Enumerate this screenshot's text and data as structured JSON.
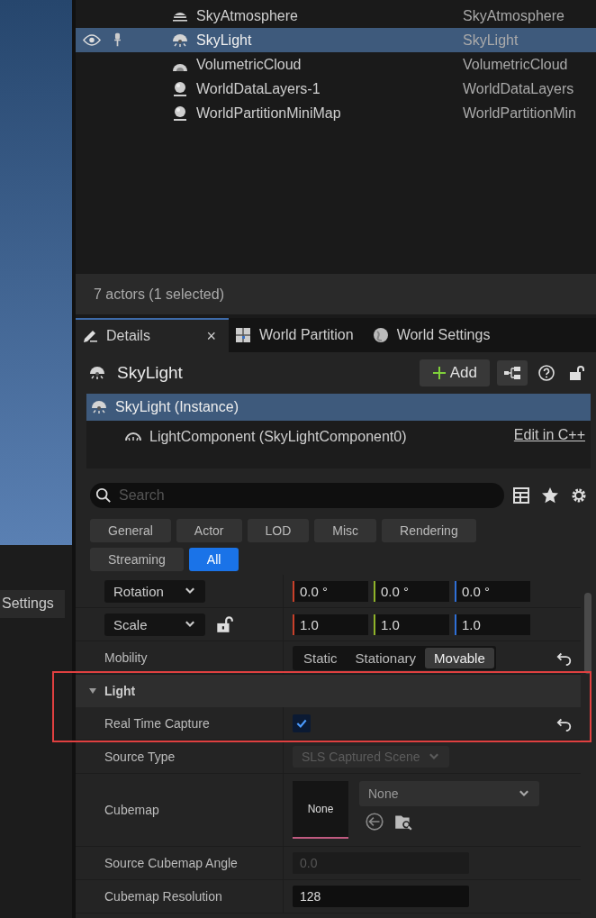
{
  "outliner": {
    "rows": [
      {
        "label": "SkyAtmosphere",
        "type": "SkyAtmosphere",
        "selected": false
      },
      {
        "label": "SkyLight",
        "type": "SkyLight",
        "selected": true
      },
      {
        "label": "VolumetricCloud",
        "type": "VolumetricCloud",
        "selected": false
      },
      {
        "label": "WorldDataLayers-1",
        "type": "WorldDataLayers",
        "selected": false
      },
      {
        "label": "WorldPartitionMiniMap",
        "type": "WorldPartitionMin",
        "selected": false
      }
    ]
  },
  "status_bar": "7 actors (1 selected)",
  "side_tab": "Settings",
  "tabs": [
    {
      "label": "Details",
      "selected": true,
      "close": "×"
    },
    {
      "label": "World Partition",
      "selected": false
    },
    {
      "label": "World Settings",
      "selected": false
    }
  ],
  "details": {
    "actor": "SkyLight",
    "add_button": "Add",
    "edit_link": "Edit in C++",
    "components": [
      {
        "label": "SkyLight (Instance)",
        "selected": true,
        "children": [
          {
            "label": "LightComponent (SkyLightComponent0)",
            "selected": false
          }
        ]
      }
    ],
    "search": {
      "placeholder": "Search"
    },
    "filters": [
      {
        "label": "General",
        "selected": false
      },
      {
        "label": "Actor",
        "selected": false
      },
      {
        "label": "LOD",
        "selected": false
      },
      {
        "label": "Misc",
        "selected": false
      },
      {
        "label": "Rendering",
        "selected": false
      },
      {
        "label": "Streaming",
        "selected": false
      },
      {
        "label": "All",
        "selected": true
      }
    ],
    "properties": [
      {
        "kind": "vector",
        "label": "Rotation",
        "values": [
          "0.0 °",
          "0.0 °",
          "0.0 °"
        ]
      },
      {
        "kind": "vector",
        "label": "Scale",
        "values": [
          "1.0",
          "1.0",
          "1.0"
        ],
        "lock": true
      },
      {
        "kind": "segmented",
        "label": "Mobility",
        "options": [
          {
            "label": "Static",
            "selected": false
          },
          {
            "label": "Stationary",
            "selected": false
          },
          {
            "label": "Movable",
            "selected": true
          }
        ],
        "reset": true
      },
      {
        "kind": "category",
        "label": "Light",
        "expanded": true,
        "highlighted": true
      },
      {
        "kind": "checkbox",
        "label": "Real Time Capture",
        "checked": true,
        "reset": true,
        "highlighted": true
      },
      {
        "kind": "dropdown",
        "label": "Source Type",
        "value": "SLS Captured Scene",
        "disabled": true
      },
      {
        "kind": "asset",
        "label": "Cubemap",
        "thumbnail": "None",
        "value": "None"
      },
      {
        "kind": "number",
        "label": "Source Cubemap Angle",
        "value": "0.0",
        "disabled": true
      },
      {
        "kind": "number",
        "label": "Cubemap Resolution",
        "value": "128",
        "disabled": false
      }
    ]
  }
}
